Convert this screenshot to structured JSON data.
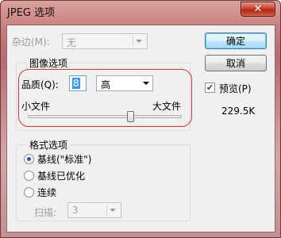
{
  "window": {
    "title": "JPEG 选项",
    "close_glyph": "✕"
  },
  "matte": {
    "label": "杂边(M):",
    "value": "无"
  },
  "buttons": {
    "ok": "确定",
    "cancel": "取消"
  },
  "preview": {
    "label": "预览(P)",
    "checked": true,
    "size": "229.5K"
  },
  "image_options": {
    "title": "图像选项",
    "quality_label": "品质(Q):",
    "quality_value": "8",
    "quality_level": "高",
    "small_file": "小文件",
    "large_file": "大文件",
    "slider_value_fraction": 0.67
  },
  "format_options": {
    "title": "格式选项",
    "choices": [
      "基线(\"标准\")",
      "基线已优化",
      "连续"
    ],
    "selected_index": 0,
    "scans_label": "扫描:",
    "scans_value": "3"
  }
}
